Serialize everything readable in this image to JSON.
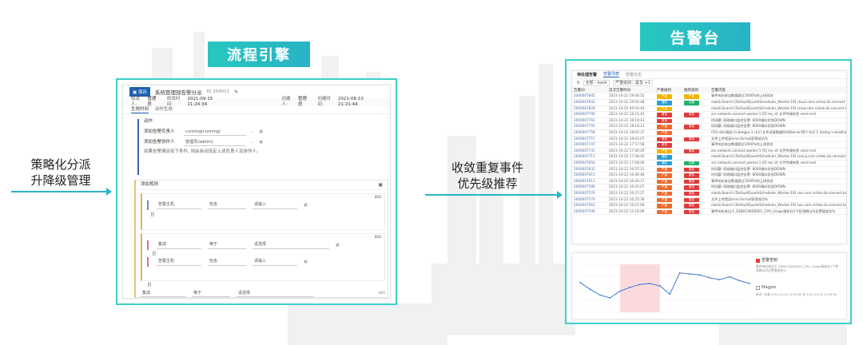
{
  "headers": {
    "workflow": "流程引擎",
    "alerts": "告警台"
  },
  "left_caption": {
    "line1": "策略化分派",
    "line2": "升降级管理"
  },
  "mid_caption": {
    "line1": "收敛重复事件",
    "line2": "优先级推荐"
  },
  "workflow": {
    "save": "保存",
    "title": "系统管理部告警分派",
    "id": "ID 354011",
    "editor_label": "修改人:",
    "editor": "管理员",
    "modified_label": "修改时间:",
    "modified": "2021-09-15 11:24:34",
    "creator_label": "创建人:",
    "creator": "管理员",
    "created_label": "创建时间:",
    "created": "2021-08-10 21:21:44",
    "tabs": [
      "生效时间",
      "动作生效"
    ],
    "action_title": "动作",
    "actions": [
      {
        "label": "添加告警负责人",
        "value": "cunning(cunning)"
      },
      {
        "label": "添加告警协作人",
        "value": "管理员(admin)"
      }
    ],
    "note": "如果告警满足如下条件, 则会自动设定上述负责人及协作人。",
    "rule_title": "添加规则",
    "rules": [
      {
        "field": "告警主机",
        "op": "包含",
        "value": "请输入"
      },
      {
        "field": "集成",
        "op": "等于",
        "value": "请选择"
      },
      {
        "field": "告警主机",
        "op": "包含",
        "value": "请输入"
      },
      {
        "field": "集成",
        "op": "等于",
        "value": "请选择"
      }
    ],
    "connector": "且"
  },
  "alert": {
    "tabs": [
      "待处理告警",
      "告警列表",
      "告警日志"
    ],
    "filter_chips": [
      "全部 - bank",
      "严重级别：紧急 +1"
    ],
    "columns": [
      "告警ID",
      "首次告警时间",
      "严重级别",
      "推荐级别",
      "告警内容"
    ],
    "rows": [
      {
        "id": "2000007845",
        "time": "2021-10-22 19:06:52",
        "sev": "严重",
        "sevc": "#f0b400",
        "rec": "严重",
        "recc": "#f0b400",
        "content": "事件响应来自数据超过1000%的上线状态"
      },
      {
        "id": "2000007842",
        "time": "2021-10-22 19:02:48",
        "sev": "通知",
        "sevc": "#2a9fd6",
        "rec": "次要",
        "recc": "#1fb36b",
        "content": "elasticSearch [DefaultQuartzScheduler_Worker-19] cloud.com.scitek.do.connect.kafka..."
      },
      {
        "id": "2000007828",
        "time": "2021-10-22 09:54:44",
        "sev": "严重",
        "sevc": "#f0b400",
        "rec": "",
        "recc": "",
        "content": "elasticSearch [DefaultQuartzScheduler_Worker-19] snow.com.scitek.do.connect.kafka..."
      },
      {
        "id": "2000007796",
        "time": "2021-10-22 18:21:42",
        "sev": "紧急",
        "sevc": "#e23b3b",
        "rec": "紧急",
        "recc": "#e23b3b",
        "content": "arc.network.connect.worker-1 [0] my sit 文件传输失败 send end"
      },
      {
        "id": "2000007793",
        "time": "2021-10-22 18:19:43",
        "sev": "紧急",
        "sevc": "#e23b3b",
        "rec": "",
        "recc": "",
        "content": "时间戳: 网络端口监控告警: 8000端口状态DOWN"
      },
      {
        "id": "2000007791",
        "time": "2021-10-22 18:18:12",
        "sev": "严重",
        "sevc": "#ef6b2c",
        "rec": "紧急",
        "recc": "#e23b3b",
        "content": "时间戳: 网络端口监控告警: 8000端口状态DOWN"
      },
      {
        "id": "2000007758",
        "time": "2021-10-22 18:05:37",
        "sev": "严重",
        "sevc": "#ef6b2c",
        "rec": "",
        "recc": "",
        "content": "CPU-slb1服务 [cubegpo-1 ck2] 文件读取数据时间[Kerror]等个节点下 [today's weather s.c..."
      },
      {
        "id": "2000007757",
        "time": "2021-10-22 18:02:07",
        "sev": "紧急",
        "sevc": "#e23b3b",
        "rec": "紧急",
        "recc": "#e23b3b",
        "content": "文件上传错误error.format获得成功%"
      },
      {
        "id": "2000007747",
        "time": "2021-10-22 17:57:58",
        "sev": "紧急",
        "sevc": "#e23b3b",
        "rec": "",
        "recc": "",
        "content": "事件响应来自数据超过1000%的上线状态"
      },
      {
        "id": "2000007731",
        "time": "2021-10-22 17:46:29",
        "sev": "严重",
        "sevc": "#f0b400",
        "rec": "紧急",
        "recc": "#e23b3b",
        "content": "arc.network.connect.worker-1 [0] my sit 文件传输失败 send end"
      },
      {
        "id": "2000007711",
        "time": "2021-10-22 17:38:20",
        "sev": "通知",
        "sevc": "#2a9fd6",
        "rec": "",
        "recc": "",
        "content": "elasticSearch [DefaultQuartzScheduler_Worker-19] sunny.com.scitek.do.connect.kafka..."
      },
      {
        "id": "2000007656",
        "time": "2021-10-22 17:08:00",
        "sev": "通知",
        "sevc": "#2a9fd6",
        "rec": "次要",
        "recc": "#1fb36b",
        "content": "arc.network.connect.worker-1 [0] my sit 文件传输失败 send end"
      },
      {
        "id": "2000007632",
        "time": "2021-10-22 16:57:31",
        "sev": "严重",
        "sevc": "#ef6b2c",
        "rec": "紧急",
        "recc": "#e23b3b",
        "content": "时间戳: 网络端口监控告警: 8000端口状态DOWN"
      },
      {
        "id": "2000007615",
        "time": "2021-10-22 16:46:48",
        "sev": "严重",
        "sevc": "#ef6b2c",
        "rec": "紧急",
        "recc": "#e23b3b",
        "content": "时间戳: 网络端口监控告警: 8000端口状态DOWN"
      },
      {
        "id": "2000007611",
        "time": "2021-10-22 16:40:17",
        "sev": "严重",
        "sevc": "#ef6b2c",
        "rec": "紧急",
        "recc": "#e23b3b",
        "content": "事件响应来自数据超过1000%的上线状态"
      },
      {
        "id": "2000007589",
        "time": "2021-10-22 16:25:07",
        "sev": "严重",
        "sevc": "#ef6b2c",
        "rec": "紧急",
        "recc": "#e23b3b",
        "content": "时间戳: 网络端口监控告警: 8000端口状态DOWN"
      },
      {
        "id": "2000007574",
        "time": "2021-10-22 16:27:27",
        "sev": "严重",
        "sevc": "#ef6b2c",
        "rec": "紧急",
        "recc": "#e23b3b",
        "content": "elasticSearch [DefaultQuartzScheduler_Worker-19] son.com.scitek.do.connect.kafka..."
      },
      {
        "id": "2000007570",
        "time": "2021-10-22 16:25:36",
        "sev": "严重",
        "sevc": "#ef6b2c",
        "rec": "紧急",
        "recc": "#e23b3b",
        "content": "文件上传错误error.format获得成功%"
      },
      {
        "id": "2000007561",
        "time": "2021-10-22 16:21:09",
        "sev": "严重",
        "sevc": "#ef6b2c",
        "rec": "紧急",
        "recc": "#e23b3b",
        "content": "elasticSearch [DefaultQuartzScheduler_Worker-19] son.com.scitek.do.connect.kafka..."
      },
      {
        "id": "2000007549",
        "time": "2021-10-22 12:18:09",
        "sev": "严重",
        "sevc": "#ef6b2c",
        "rec": "紧急",
        "recc": "#e23b3b",
        "content": "事件响应来自于_ESB01/WDS001_CPU_Usage指标在1个检测期以内告警值变化%"
      }
    ],
    "chart_panel": {
      "legend": "告警告知",
      "text1": "事件响应来自于_ESB01/WDS001_CPU_Usage指标在1个检",
      "text2": "测期以内告警值变化%",
      "check_label": "Magpie",
      "range": "单次一历程  2021-10-22 12:33:00 至 2021-10-22 12:39:00"
    }
  },
  "chart_data": {
    "type": "line",
    "x": [
      0,
      1,
      2,
      3,
      4,
      5,
      6,
      7,
      8,
      9,
      10,
      11,
      12,
      13,
      14,
      15,
      16,
      17
    ],
    "series": [
      {
        "values": [
          62,
          48,
          36,
          30,
          44,
          52,
          58,
          60,
          55,
          38,
          82,
          80,
          78,
          72,
          68,
          74,
          66,
          60
        ]
      }
    ],
    "ylim": [
      0,
      100
    ],
    "highlight_range": [
      4,
      8
    ]
  }
}
